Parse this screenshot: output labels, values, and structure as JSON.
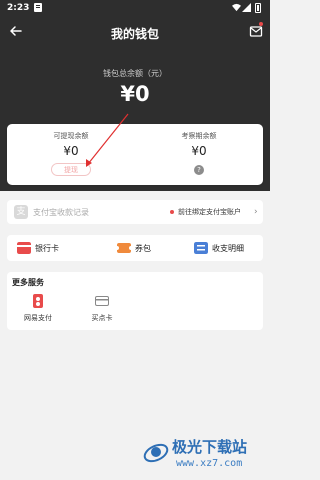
{
  "status_bar": {
    "time": "2:23"
  },
  "header": {
    "title": "我的钱包"
  },
  "wallet": {
    "total_label": "钱包总余额（元）",
    "total_amount": "¥0"
  },
  "balance_card": {
    "withdrawable_label": "可提现余额",
    "withdrawable_value": "¥0",
    "withdraw_button": "提现",
    "review_label": "考察期余额",
    "review_value": "¥0",
    "help_glyph": "?"
  },
  "alipay": {
    "icon_glyph": "支",
    "label": "支付宝收款记录",
    "link": "前往绑定支付宝账户",
    "chevron": "›"
  },
  "quick_actions": [
    {
      "label": "银行卡",
      "icon": "bank-card-icon",
      "color": "#e84b4b"
    },
    {
      "label": "券包",
      "icon": "coupon-icon",
      "color": "#f08a3c"
    },
    {
      "label": "收支明细",
      "icon": "bill-detail-icon",
      "color": "#4a7fd6"
    }
  ],
  "services": {
    "title": "更多服务",
    "items": [
      {
        "label": "网易支付",
        "icon": "netease-pay-icon",
        "color": "#e84b4b"
      },
      {
        "label": "买点卡",
        "icon": "point-card-icon",
        "color": "#888888"
      }
    ]
  },
  "watermark": {
    "title": "极光下载站",
    "url": "www.xz7.com"
  }
}
